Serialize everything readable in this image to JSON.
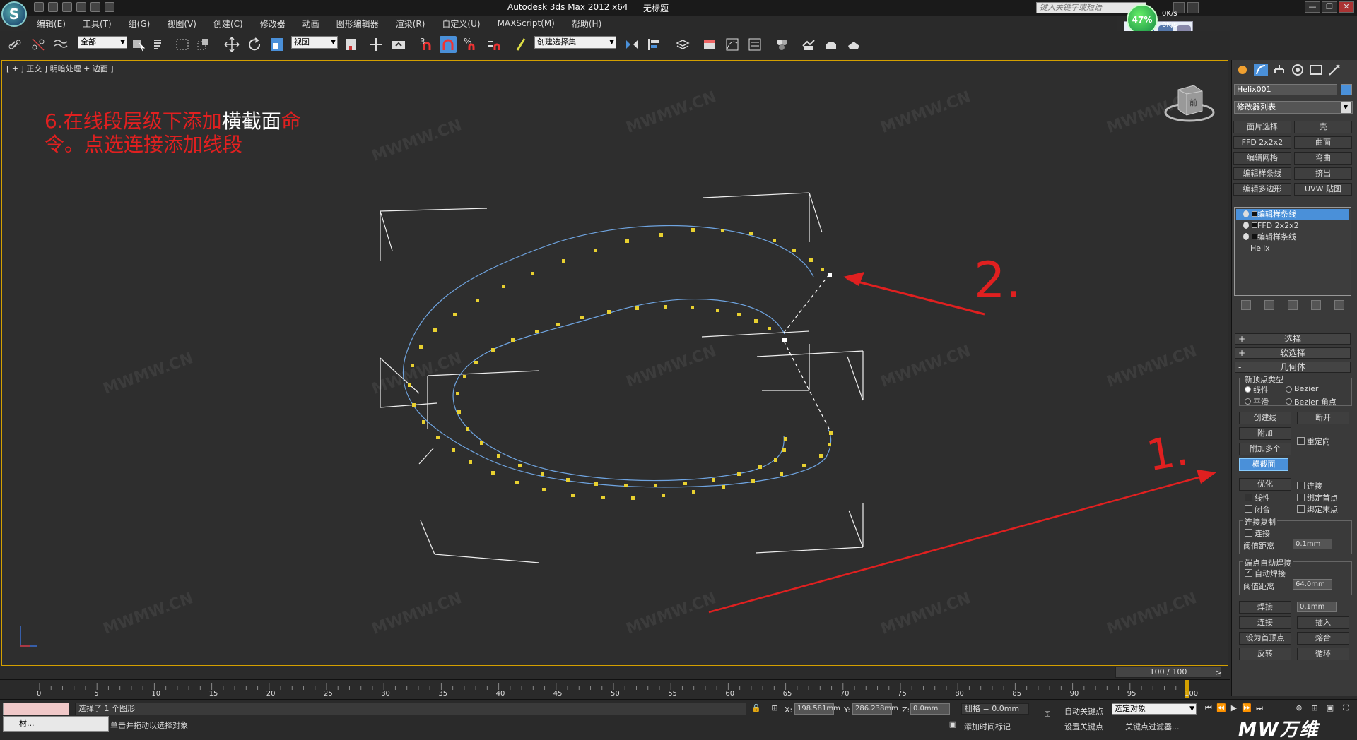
{
  "titlebar": {
    "app_logo": "S",
    "title": "Autodesk 3ds Max  2012 x64",
    "subtitle": "无标题",
    "search_placeholder": "键入关键字或短语",
    "controls": {
      "minimize": "—",
      "restore": "❐",
      "close": "✕"
    }
  },
  "menu": [
    "编辑(E)",
    "工具(T)",
    "组(G)",
    "视图(V)",
    "创建(C)",
    "修改器",
    "动画",
    "图形编辑器",
    "渲染(R)",
    "自定义(U)",
    "MAXScript(M)",
    "帮助(H)"
  ],
  "netmon": {
    "percent": "47%",
    "up": "0K/s",
    "down": "0K/s"
  },
  "toolbar": {
    "selection_filter": "全部",
    "ref_coord": "视图",
    "named_sel": "创建选择集",
    "snap_label": "3",
    "percent_snap": "%"
  },
  "viewport": {
    "label": "[ + ] 正交 ] 明暗处理 + 边面 ]",
    "annotation_line1_red": "6.在线段层级下添加",
    "annotation_line1_white": "横截面",
    "annotation_line1_red2": "命",
    "annotation_line2": "令。点选连接添加线段",
    "mark_two": "2.",
    "mark_one": "1.",
    "watermark": "MWMW.CN",
    "cube_label": "前"
  },
  "cmdpanel": {
    "object_name": "Helix001",
    "modifier_list": "修改器列表",
    "mod_buttons": [
      [
        "面片选择",
        "壳"
      ],
      [
        "FFD 2x2x2",
        "曲面"
      ],
      [
        "编辑网格",
        "弯曲"
      ],
      [
        "编辑样条线",
        "挤出"
      ],
      [
        "编辑多边形",
        "UVW 贴图"
      ]
    ],
    "stack": [
      "编辑样条线",
      "FFD 2x2x2",
      "编辑样条线",
      "Helix"
    ],
    "rollouts": {
      "select": "选择",
      "soft": "软选择",
      "geometry": "几何体"
    },
    "new_vertex_type": "新顶点类型",
    "radio_linear": "线性",
    "radio_bezier": "Bezier",
    "radio_smooth": "平滑",
    "radio_bezier_corner": "Bezier 角点",
    "btn_create_line": "创建线",
    "btn_break": "断开",
    "btn_attach": "附加",
    "btn_attach_mult": "附加多个",
    "chk_reorient": "重定向",
    "btn_cross_section": "横截面",
    "btn_refine": "优化",
    "chk_connect": "连接",
    "chk_linear": "线性",
    "chk_bind_first": "绑定首点",
    "chk_closed": "闭合",
    "chk_bind_last": "绑定末点",
    "connect_copy": "连接复制",
    "chk_connect2": "连接",
    "threshold": "阈值距离",
    "threshold_val": "0.1mm",
    "end_weld": "端点自动焊接",
    "chk_auto_weld": "自动焊接",
    "threshold2": "阈值距离",
    "threshold2_val": "64.0mm",
    "btn_weld": "焊接",
    "weld_val": "0.1mm",
    "btn_connect": "连接",
    "btn_insert": "插入",
    "btn_make_first": "设为首顶点",
    "btn_fuse": "熔合",
    "btn_reverse": "反转",
    "btn_cycle": "循环"
  },
  "timeline": {
    "slider": "100 / 100",
    "ticks": [
      "0",
      "5",
      "10",
      "15",
      "20",
      "25",
      "30",
      "35",
      "40",
      "45",
      "50",
      "55",
      "60",
      "65",
      "70",
      "75",
      "80",
      "85",
      "90",
      "95",
      "100"
    ]
  },
  "status": {
    "selected": "选择了 1 个图形",
    "prompt": "单击并拖动以选择对象",
    "x_label": "X:",
    "x_val": "198.581mm",
    "y_label": "Y:",
    "y_val": "286.238mm",
    "z_label": "Z:",
    "z_val": "0.0mm",
    "grid": "栅格 = 0.0mm",
    "add_marker": "添加时间标记",
    "auto_key": "自动关键点",
    "set_key": "设置关键点",
    "sel_set": "选定对象",
    "key_filter": "关键点过滤器...",
    "brand": "MW万维",
    "task_item": "材..."
  }
}
